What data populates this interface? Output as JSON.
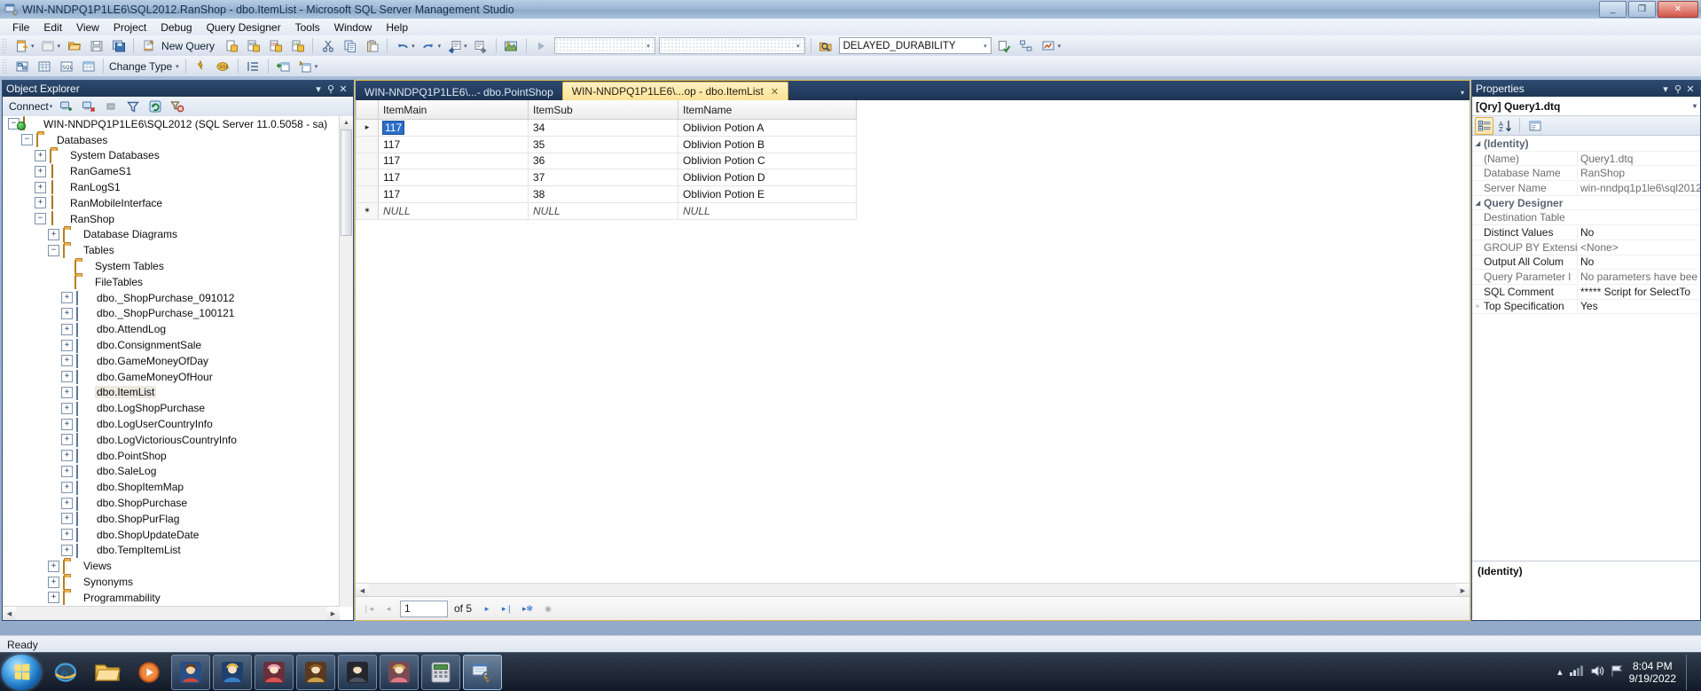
{
  "window": {
    "title": "WIN-NNDPQ1P1LE6\\SQL2012.RanShop - dbo.ItemList - Microsoft SQL Server Management Studio",
    "minimize_label": "_",
    "maximize_label": "❐",
    "close_label": "✕"
  },
  "menu": {
    "items": [
      "File",
      "Edit",
      "View",
      "Project",
      "Debug",
      "Query Designer",
      "Tools",
      "Window",
      "Help"
    ]
  },
  "toolbar1": {
    "new_query_label": "New Query",
    "delayed_durability_value": "DELAYED_DURABILITY",
    "combo1_value": "",
    "combo2_value": "",
    "icons": [
      "new-item-icon",
      "new-project-icon",
      "open-file-icon",
      "save-icon",
      "save-all-icon",
      "new-query-icon",
      "database-engine-query-icon",
      "analysis-mdx-query-icon",
      "analysis-dmx-query-icon",
      "analysis-xmla-query-icon",
      "cut-icon",
      "copy-icon",
      "paste-icon",
      "undo-icon",
      "redo-icon",
      "navigate-backward-icon",
      "navigate-forward-icon",
      "toolbox-icon",
      "execute-icon",
      "available-databases-icon"
    ]
  },
  "toolbar2": {
    "change_type_label": "Change Type",
    "icons": [
      "show-diagram-pane-icon",
      "show-criteria-pane-icon",
      "show-sql-pane-icon",
      "show-results-pane-icon",
      "verify-sql-icon",
      "execute-sql-icon",
      "group-by-icon",
      "add-table-icon",
      "add-new-derived-table-icon"
    ]
  },
  "object_explorer": {
    "title": "Object Explorer",
    "connect_label": "Connect",
    "toolbar_icons": [
      "connect-icon",
      "disconnect-icon",
      "stop-icon",
      "filter-icon",
      "refresh-icon",
      "clear-filter-icon"
    ],
    "panel_buttons": [
      "dropdown-icon",
      "pin-icon",
      "close-icon"
    ],
    "tree": [
      {
        "label": "WIN-NNDPQ1P1LE6\\SQL2012 (SQL Server 11.0.5058 - sa)",
        "indent": 0,
        "expander": "minus",
        "icon": "server-icon"
      },
      {
        "label": "Databases",
        "indent": 1,
        "expander": "minus",
        "icon": "folder-icon"
      },
      {
        "label": "System Databases",
        "indent": 2,
        "expander": "plus",
        "icon": "folder-icon"
      },
      {
        "label": "RanGameS1",
        "indent": 2,
        "expander": "plus",
        "icon": "database-icon"
      },
      {
        "label": "RanLogS1",
        "indent": 2,
        "expander": "plus",
        "icon": "database-icon"
      },
      {
        "label": "RanMobileInterface",
        "indent": 2,
        "expander": "plus",
        "icon": "database-icon"
      },
      {
        "label": "RanShop",
        "indent": 2,
        "expander": "minus",
        "icon": "database-icon"
      },
      {
        "label": "Database Diagrams",
        "indent": 3,
        "expander": "plus",
        "icon": "folder-icon"
      },
      {
        "label": "Tables",
        "indent": 3,
        "expander": "minus",
        "icon": "folder-icon"
      },
      {
        "label": "System Tables",
        "indent": 4,
        "expander": "none",
        "icon": "folder-icon"
      },
      {
        "label": "FileTables",
        "indent": 4,
        "expander": "none",
        "icon": "folder-icon"
      },
      {
        "label": "dbo._ShopPurchase_091012",
        "indent": 4,
        "expander": "plus",
        "icon": "table-icon"
      },
      {
        "label": "dbo._ShopPurchase_100121",
        "indent": 4,
        "expander": "plus",
        "icon": "table-icon"
      },
      {
        "label": "dbo.AttendLog",
        "indent": 4,
        "expander": "plus",
        "icon": "table-icon"
      },
      {
        "label": "dbo.ConsignmentSale",
        "indent": 4,
        "expander": "plus",
        "icon": "table-icon"
      },
      {
        "label": "dbo.GameMoneyOfDay",
        "indent": 4,
        "expander": "plus",
        "icon": "table-icon"
      },
      {
        "label": "dbo.GameMoneyOfHour",
        "indent": 4,
        "expander": "plus",
        "icon": "table-icon"
      },
      {
        "label": "dbo.ItemList",
        "indent": 4,
        "expander": "plus",
        "icon": "table-icon",
        "selected": true
      },
      {
        "label": "dbo.LogShopPurchase",
        "indent": 4,
        "expander": "plus",
        "icon": "table-icon"
      },
      {
        "label": "dbo.LogUserCountryInfo",
        "indent": 4,
        "expander": "plus",
        "icon": "table-icon"
      },
      {
        "label": "dbo.LogVictoriousCountryInfo",
        "indent": 4,
        "expander": "plus",
        "icon": "table-icon"
      },
      {
        "label": "dbo.PointShop",
        "indent": 4,
        "expander": "plus",
        "icon": "table-icon"
      },
      {
        "label": "dbo.SaleLog",
        "indent": 4,
        "expander": "plus",
        "icon": "table-icon"
      },
      {
        "label": "dbo.ShopItemMap",
        "indent": 4,
        "expander": "plus",
        "icon": "table-icon"
      },
      {
        "label": "dbo.ShopPurchase",
        "indent": 4,
        "expander": "plus",
        "icon": "table-icon"
      },
      {
        "label": "dbo.ShopPurFlag",
        "indent": 4,
        "expander": "plus",
        "icon": "table-icon"
      },
      {
        "label": "dbo.ShopUpdateDate",
        "indent": 4,
        "expander": "plus",
        "icon": "table-icon"
      },
      {
        "label": "dbo.TempItemList",
        "indent": 4,
        "expander": "plus",
        "icon": "table-icon"
      },
      {
        "label": "Views",
        "indent": 3,
        "expander": "plus",
        "icon": "folder-icon"
      },
      {
        "label": "Synonyms",
        "indent": 3,
        "expander": "plus",
        "icon": "folder-icon"
      },
      {
        "label": "Programmability",
        "indent": 3,
        "expander": "plus",
        "icon": "folder-icon"
      }
    ]
  },
  "document": {
    "tabs": [
      {
        "label": "WIN-NNDPQ1P1LE6\\...- dbo.PointShop",
        "active": false,
        "closable": false
      },
      {
        "label": "WIN-NNDPQ1P1LE6\\...op - dbo.ItemList",
        "active": true,
        "closable": true,
        "close_label": "✕"
      }
    ],
    "tabstrip_caret": "▾",
    "grid": {
      "columns": [
        "ItemMain",
        "ItemSub",
        "ItemName"
      ],
      "rows": [
        {
          "marker": "▸",
          "cells": [
            "117",
            "34",
            "Oblivion Potion A"
          ],
          "selected_cell": 0
        },
        {
          "marker": "",
          "cells": [
            "117",
            "35",
            "Oblivion Potion B"
          ]
        },
        {
          "marker": "",
          "cells": [
            "117",
            "36",
            "Oblivion Potion C"
          ]
        },
        {
          "marker": "",
          "cells": [
            "117",
            "37",
            "Oblivion Potion D"
          ]
        },
        {
          "marker": "",
          "cells": [
            "117",
            "38",
            "Oblivion Potion E"
          ]
        },
        {
          "marker": "✶",
          "cells": [
            "NULL",
            "NULL",
            "NULL"
          ],
          "is_null_row": true
        }
      ]
    },
    "nav": {
      "first_label": "❘◂",
      "prev_label": "◂",
      "page_value": "1",
      "of_label": "of 5",
      "next_label": "▸",
      "last_label": "▸❘",
      "new_label": "▸✻",
      "stop_label": "◉"
    }
  },
  "properties": {
    "title": "Properties",
    "panel_buttons": [
      "dropdown-icon",
      "pin-icon",
      "close-icon"
    ],
    "object_name": "[Qry] Query1.dtq",
    "object_dropdown": "▾",
    "toolbar_icons": [
      "categorized-icon",
      "alphabetical-icon",
      "property-pages-icon"
    ],
    "rows": [
      {
        "type": "category",
        "expander": "◢",
        "name": "(Identity)"
      },
      {
        "type": "prop",
        "name": "(Name)",
        "value": "Query1.dtq",
        "dim": true
      },
      {
        "type": "prop",
        "name": "Database Name",
        "value": "RanShop",
        "dim": true
      },
      {
        "type": "prop",
        "name": "Server Name",
        "value": "win-nndpq1p1le6\\sql2012",
        "dim": true
      },
      {
        "type": "category",
        "expander": "◢",
        "name": "Query Designer"
      },
      {
        "type": "prop",
        "name": "Destination Table",
        "value": "",
        "dim": true
      },
      {
        "type": "prop",
        "name": "Distinct Values",
        "value": "No",
        "dim": false
      },
      {
        "type": "prop",
        "name": "GROUP BY Extensi",
        "value": "<None>",
        "dim": true
      },
      {
        "type": "prop",
        "name": "Output All Colum",
        "value": "No",
        "dim": false
      },
      {
        "type": "prop",
        "name": "Query Parameter l",
        "value": "No parameters have bee",
        "dim": true
      },
      {
        "type": "prop",
        "name": "SQL Comment",
        "value": "***** Script for SelectTo",
        "dim": false
      },
      {
        "type": "prop",
        "name": "Top Specification",
        "value": "Yes",
        "dim": false,
        "expander": "▹"
      }
    ],
    "description_title": "(Identity)",
    "description_text": ""
  },
  "statusbar": {
    "text": "Ready"
  },
  "taskbar": {
    "start_label": "Start",
    "items": [
      {
        "name": "internet-explorer-icon",
        "running": false
      },
      {
        "name": "windows-explorer-icon",
        "running": false
      },
      {
        "name": "media-player-icon",
        "running": false
      },
      {
        "name": "game-app-icon-1",
        "running": true
      },
      {
        "name": "game-app-icon-2",
        "running": true
      },
      {
        "name": "game-app-icon-3",
        "running": true
      },
      {
        "name": "game-app-icon-4",
        "running": true
      },
      {
        "name": "game-app-icon-5",
        "running": true
      },
      {
        "name": "game-app-icon-6",
        "running": true
      },
      {
        "name": "calculator-icon",
        "running": true
      },
      {
        "name": "sql-server-management-studio-icon",
        "running": true,
        "active": true
      }
    ],
    "tray": {
      "show_hidden_label": "▴",
      "network_label": "network-icon",
      "volume_label": "volume-icon",
      "action_center_label": "flag-icon",
      "time": "8:04 PM",
      "date": "9/19/2022"
    }
  },
  "colors": {
    "accent_blue": "#2c4a70",
    "active_tab": "#fbe394",
    "selection_blue": "#2a6fc9",
    "titlebar": "#9db6d4"
  }
}
